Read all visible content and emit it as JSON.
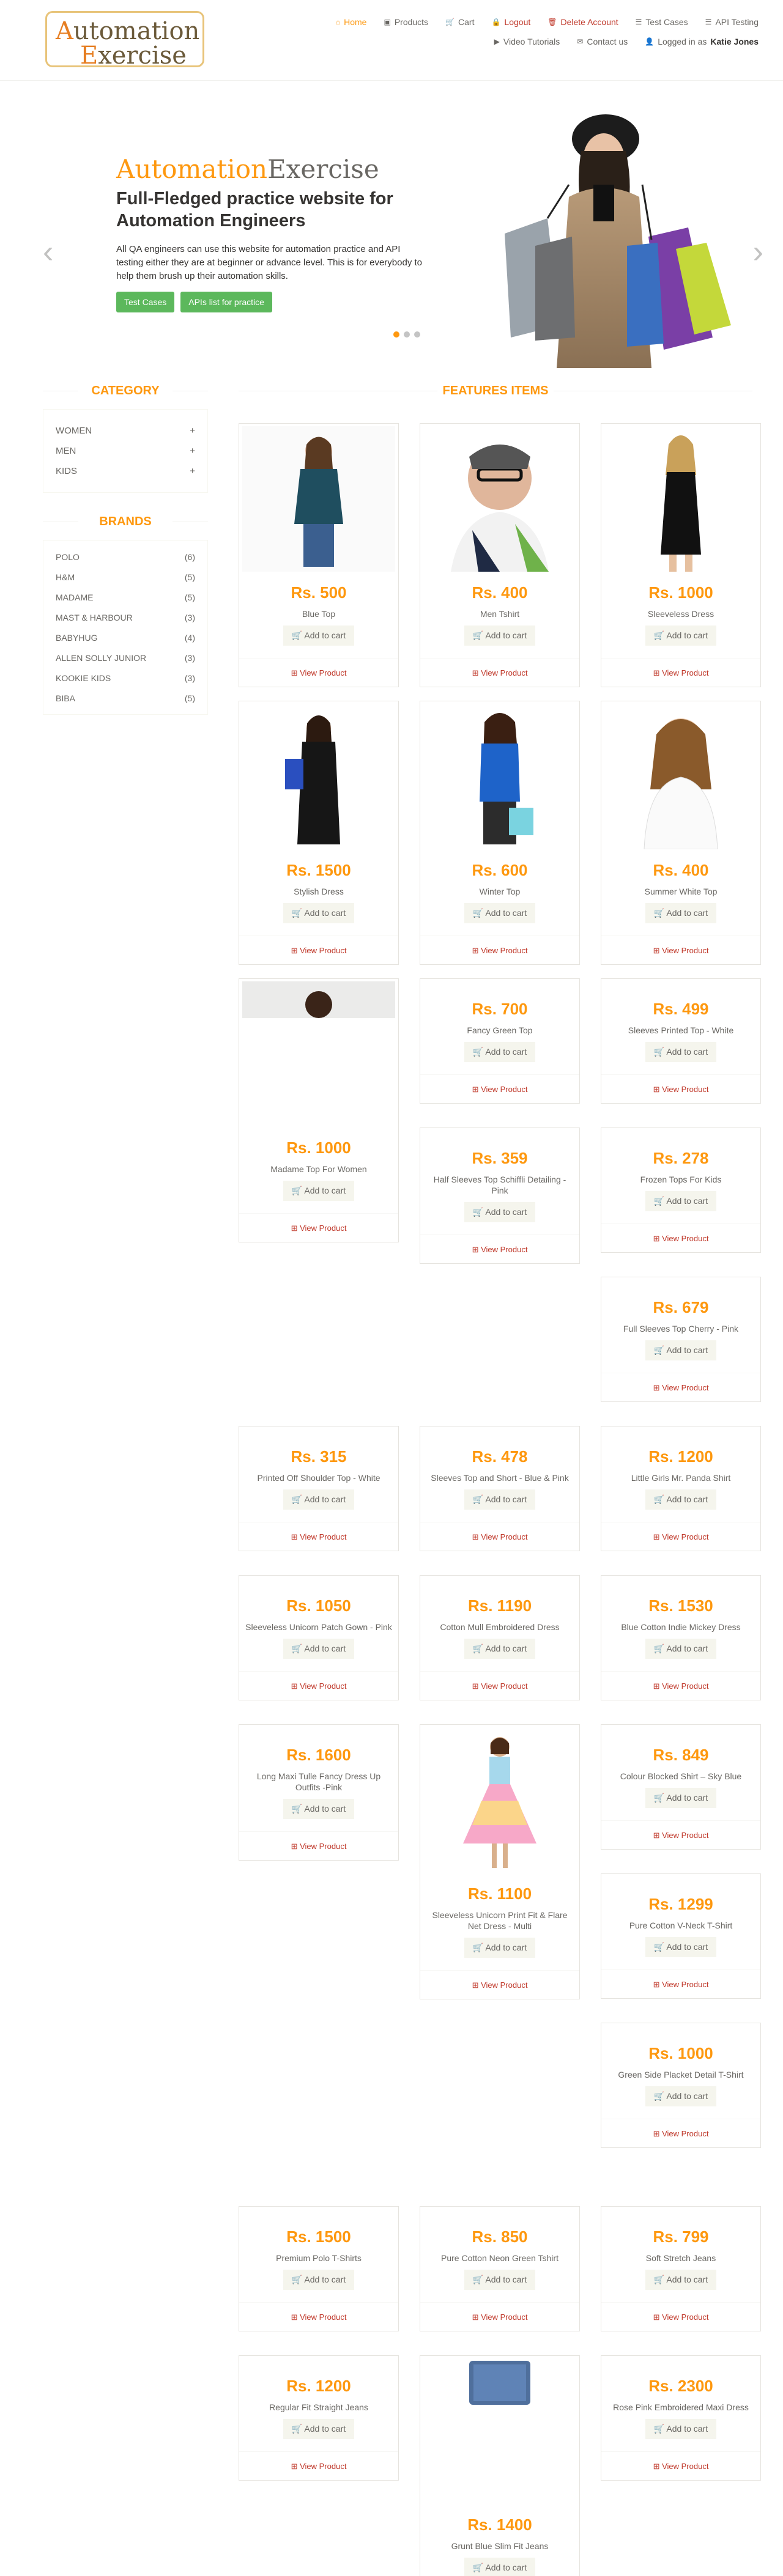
{
  "logo": {
    "line1_cap": "A",
    "line1_rest": "utomation",
    "line2_cap": "E",
    "line2_rest": "xercise"
  },
  "nav": [
    {
      "icon": "home-icon",
      "glyph": "⌂",
      "label": "Home",
      "style": "active"
    },
    {
      "icon": "products-icon",
      "glyph": "▣",
      "label": "Products",
      "style": ""
    },
    {
      "icon": "cart-icon",
      "glyph": "🛒",
      "label": "Cart",
      "style": ""
    },
    {
      "icon": "lock-icon",
      "glyph": "🔒",
      "label": "Logout",
      "style": "red"
    },
    {
      "icon": "trash-icon",
      "glyph": "🗑",
      "label": "Delete Account",
      "style": "red"
    },
    {
      "icon": "list-icon",
      "glyph": "☰",
      "label": "Test Cases",
      "style": ""
    },
    {
      "icon": "list-icon",
      "glyph": "☰",
      "label": "API Testing",
      "style": ""
    },
    {
      "icon": "youtube-icon",
      "glyph": "▶",
      "label": "Video Tutorials",
      "style": ""
    },
    {
      "icon": "envelope-icon",
      "glyph": "✉",
      "label": "Contact us",
      "style": ""
    }
  ],
  "logged_in": {
    "prefix": "Logged in as",
    "user": "Katie Jones"
  },
  "slider": {
    "brand_a": "Automation",
    "brand_b": "Exercise",
    "heading": "Full-Fledged practice website for Automation Engineers",
    "text": "All QA engineers can use this website for automation practice and API testing either they are at beginner or advance level. This is for everybody to help them brush up their automation skills.",
    "btn_test_cases": "Test Cases",
    "btn_apis": "APIs list for practice",
    "prev": "‹",
    "next": "›"
  },
  "sidebar": {
    "category_title": "CATEGORY",
    "categories": [
      "WOMEN",
      "MEN",
      "KIDS"
    ],
    "plus": "+",
    "brands_title": "BRANDS",
    "brands": [
      {
        "name": "POLO",
        "count": "(6)"
      },
      {
        "name": "H&M",
        "count": "(5)"
      },
      {
        "name": "MADAME",
        "count": "(5)"
      },
      {
        "name": "MAST & HARBOUR",
        "count": "(3)"
      },
      {
        "name": "BABYHUG",
        "count": "(4)"
      },
      {
        "name": "ALLEN SOLLY JUNIOR",
        "count": "(3)"
      },
      {
        "name": "KOOKIE KIDS",
        "count": "(3)"
      },
      {
        "name": "BIBA",
        "count": "(5)"
      }
    ]
  },
  "features_title": "FEATURES ITEMS",
  "add_to_cart": "Add to cart",
  "view_product": "View Product",
  "products": [
    {
      "price": "Rs. 500",
      "name": "Blue Top"
    },
    {
      "price": "Rs. 400",
      "name": "Men Tshirt"
    },
    {
      "price": "Rs. 1000",
      "name": "Sleeveless Dress"
    },
    {
      "price": "Rs. 1500",
      "name": "Stylish Dress"
    },
    {
      "price": "Rs. 600",
      "name": "Winter Top"
    },
    {
      "price": "Rs. 400",
      "name": "Summer White Top"
    },
    {
      "price": "Rs. 1000",
      "name": "Madame Top For Women"
    },
    {
      "price": "Rs. 700",
      "name": "Fancy Green Top"
    },
    {
      "price": "Rs. 499",
      "name": "Sleeves Printed Top - White"
    },
    {
      "price": "Rs. 359",
      "name": "Half Sleeves Top Schiffli Detailing - Pink"
    },
    {
      "price": "Rs. 278",
      "name": "Frozen Tops For Kids"
    },
    {
      "price": "Rs. 679",
      "name": "Full Sleeves Top Cherry - Pink"
    },
    {
      "price": "Rs. 315",
      "name": "Printed Off Shoulder Top - White"
    },
    {
      "price": "Rs. 478",
      "name": "Sleeves Top and Short - Blue & Pink"
    },
    {
      "price": "Rs. 1200",
      "name": "Little Girls Mr. Panda Shirt"
    },
    {
      "price": "Rs. 1050",
      "name": "Sleeveless Unicorn Patch Gown - Pink"
    },
    {
      "price": "Rs. 1190",
      "name": "Cotton Mull Embroidered Dress"
    },
    {
      "price": "Rs. 1530",
      "name": "Blue Cotton Indie Mickey Dress"
    },
    {
      "price": "Rs. 1600",
      "name": "Long Maxi Tulle Fancy Dress Up Outfits -Pink"
    },
    {
      "price": "Rs. 1100",
      "name": "Sleeveless Unicorn Print Fit & Flare Net Dress - Multi"
    },
    {
      "price": "Rs. 849",
      "name": "Colour Blocked Shirt – Sky Blue"
    },
    {
      "price": "Rs. 1299",
      "name": "Pure Cotton V-Neck T-Shirt"
    },
    {
      "price": "Rs. 1000",
      "name": "Green Side Placket Detail T-Shirt"
    },
    {
      "price": "Rs. 1500",
      "name": "Premium Polo T-Shirts"
    },
    {
      "price": "Rs. 850",
      "name": "Pure Cotton Neon Green Tshirt"
    },
    {
      "price": "Rs. 799",
      "name": "Soft Stretch Jeans"
    },
    {
      "price": "Rs. 1200",
      "name": "Regular Fit Straight Jeans"
    },
    {
      "price": "Rs. 1400",
      "name": "Grunt Blue Slim Fit Jeans"
    },
    {
      "price": "Rs. 2300",
      "name": "Rose Pink Embroidered Maxi Dress"
    }
  ]
}
